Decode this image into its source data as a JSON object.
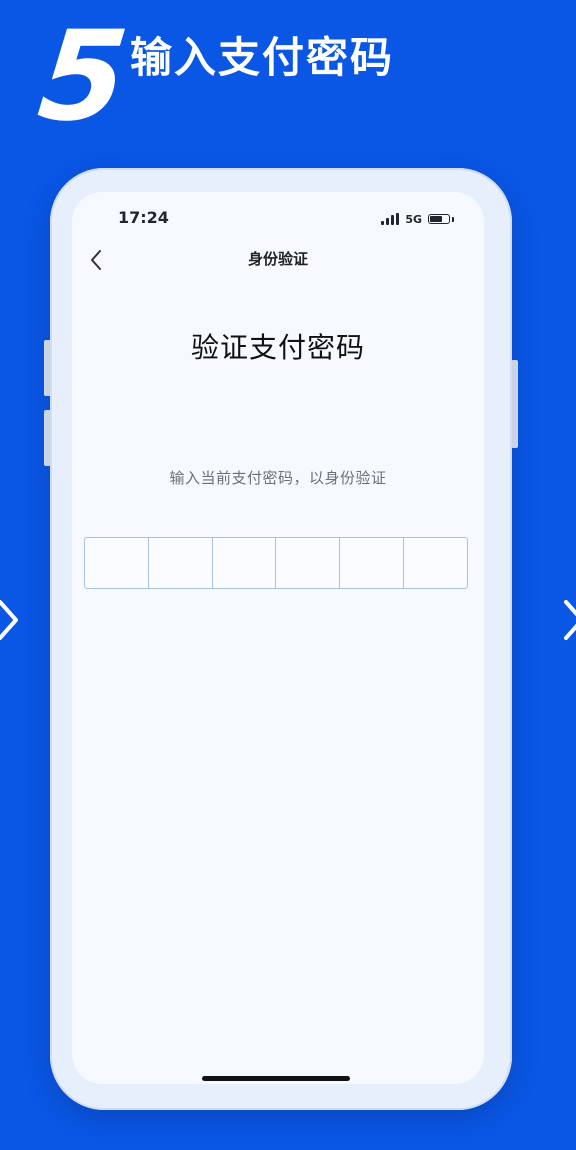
{
  "header": {
    "step_number": "5",
    "step_title": "输入支付密码"
  },
  "status_bar": {
    "time": "17:24",
    "network": "5G"
  },
  "nav": {
    "title": "身份验证"
  },
  "main": {
    "heading": "验证支付密码",
    "hint": "输入当前支付密码，以身份验证",
    "pin_length": 6
  },
  "colors": {
    "background": "#0a57e6",
    "phone_frame": "#e7effc",
    "screen": "#f6f9ff",
    "pin_border": "#a7c3dd"
  },
  "icons": {
    "back": "chevron-left-icon",
    "left_nav": "chevron-left-icon",
    "right_nav": "chevron-right-icon",
    "signal": "signal-icon",
    "battery": "battery-icon"
  }
}
